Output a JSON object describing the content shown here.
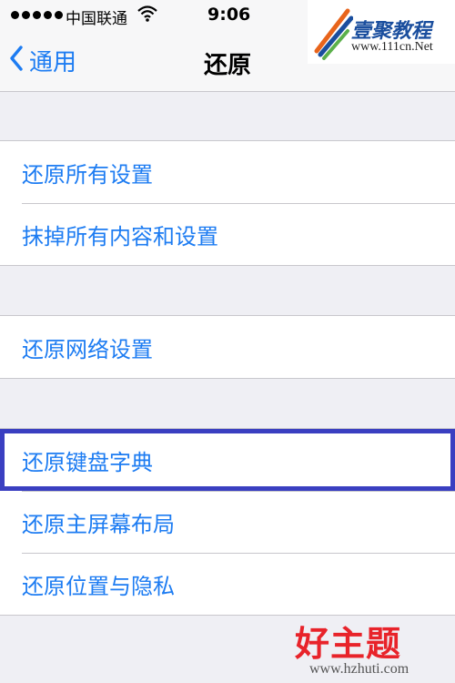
{
  "status_bar": {
    "carrier": "中国联通",
    "time": "9:06"
  },
  "nav": {
    "back_label": "通用",
    "title": "还原"
  },
  "groups": [
    {
      "items": [
        "还原所有设置",
        "抹掉所有内容和设置"
      ]
    },
    {
      "items": [
        "还原网络设置"
      ]
    },
    {
      "items": [
        "还原键盘字典",
        "还原主屏幕布局",
        "还原位置与隐私"
      ]
    }
  ],
  "highlighted_item": "还原键盘字典",
  "watermarks": {
    "top_right": {
      "brand": "壹聚教程",
      "url": "www.111cn.Net"
    },
    "bottom_right": {
      "brand": "好主题",
      "url": "www.hzhuti.com"
    }
  },
  "colors": {
    "accent": "#1d7cf2",
    "background": "#efeff4",
    "highlight_border": "#3a3fc1"
  }
}
